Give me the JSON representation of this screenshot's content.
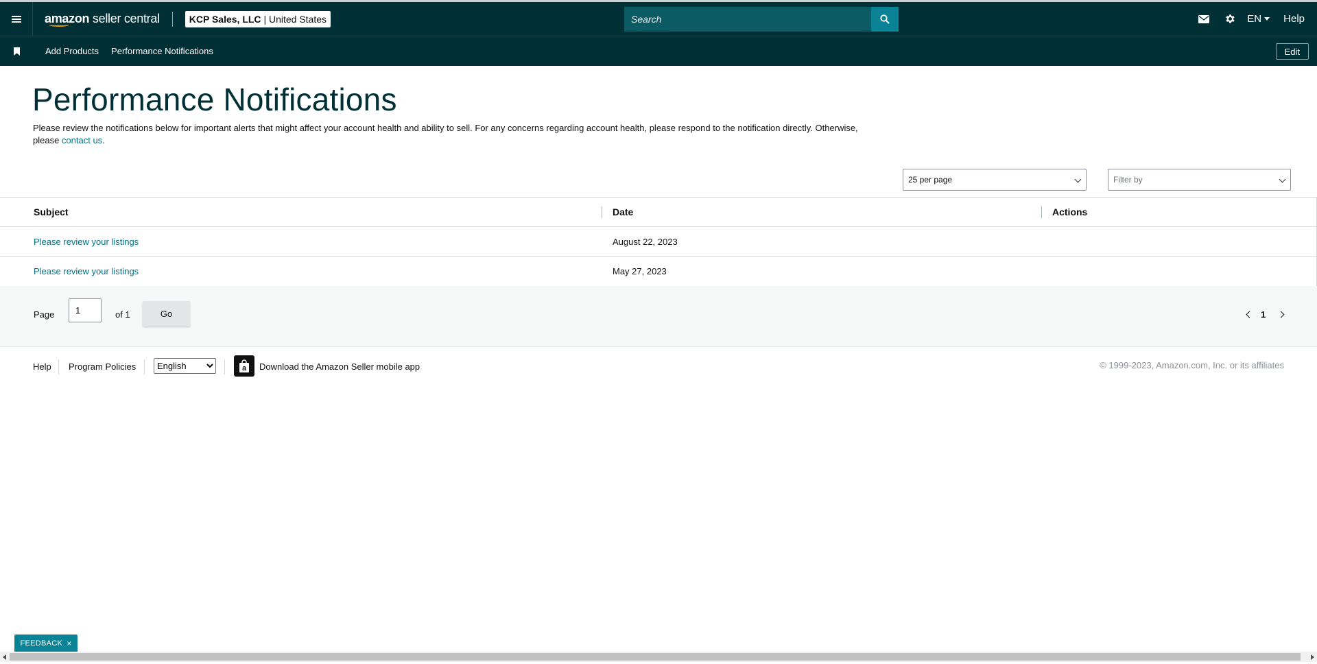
{
  "topnav": {
    "logo_brand": "amazon",
    "logo_product": "seller central",
    "account_name": "KCP Sales, LLC",
    "account_region": "| United States",
    "search_placeholder": "Search",
    "language": "EN",
    "help_label": "Help",
    "icons": [
      "menu-icon",
      "mail-icon",
      "gear-icon",
      "search-icon"
    ]
  },
  "subnav": {
    "items": [
      {
        "label": "Add Products"
      },
      {
        "label": "Performance Notifications"
      }
    ],
    "edit_label": "Edit"
  },
  "page": {
    "title": "Performance Notifications",
    "description": "Please review the notifications below for important alerts that might affect your account health and ability to sell. For any concerns regarding account health, please respond to the notification directly. Otherwise, please ",
    "contact_link": "contact us",
    "description_end": "."
  },
  "controls": {
    "per_page": "25 per page",
    "filter_placeholder": "Filter by"
  },
  "table": {
    "headers": {
      "subject": "Subject",
      "date": "Date",
      "actions": "Actions"
    },
    "rows": [
      {
        "subject": "Please review your listings",
        "date": "August 22, 2023",
        "actions": ""
      },
      {
        "subject": "Please review your listings",
        "date": "May 27, 2023",
        "actions": ""
      }
    ]
  },
  "pagination": {
    "page_label": "Page",
    "page_value": "1",
    "of_label": "of 1",
    "go_label": "Go",
    "current_page": "1"
  },
  "footer": {
    "help": "Help",
    "policies": "Program Policies",
    "language_selected": "English",
    "app_text": "Download the Amazon Seller mobile app",
    "copyright": "© 1999-2023, Amazon.com, Inc. or its affiliates"
  },
  "feedback": {
    "label": "FEEDBACK",
    "close": "×"
  },
  "colors": {
    "nav_bg": "#002f36",
    "link": "#007185",
    "accent": "#0a8396",
    "logo_smile": "#ff9900"
  }
}
